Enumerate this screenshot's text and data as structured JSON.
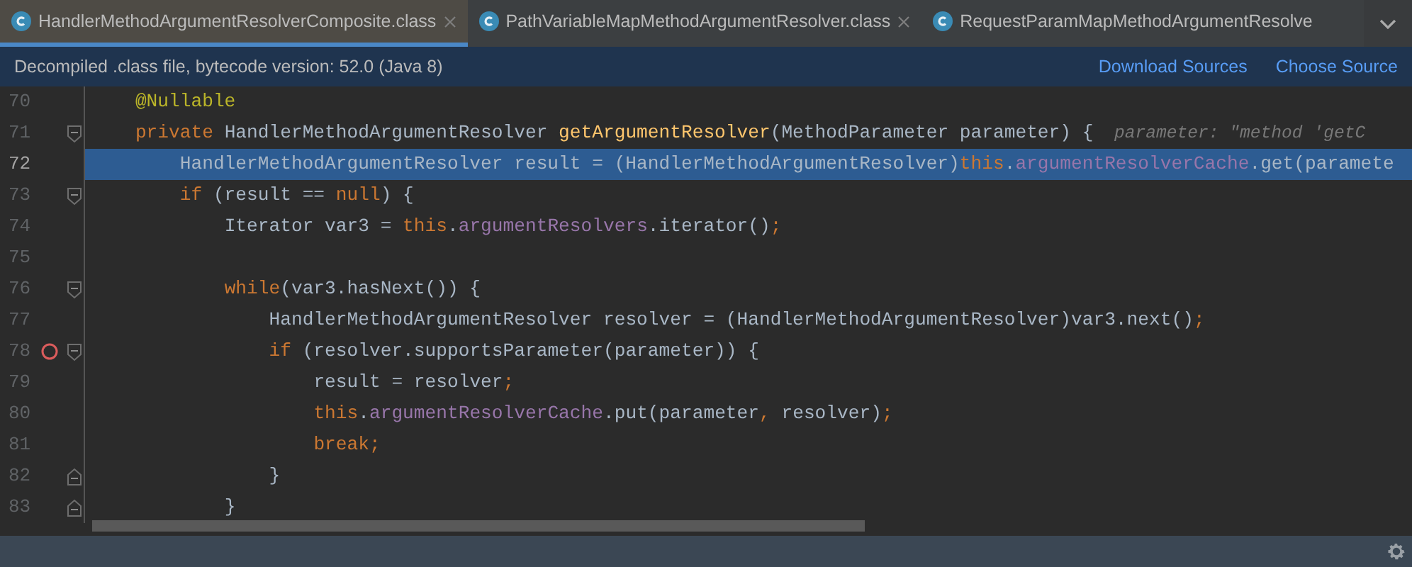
{
  "tabs": [
    {
      "label": "HandlerMethodArgumentResolverComposite.class",
      "selected": true,
      "closable": true
    },
    {
      "label": "PathVariableMapMethodArgumentResolver.class",
      "selected": false,
      "closable": true
    },
    {
      "label": "RequestParamMapMethodArgumentResolve",
      "selected": false,
      "closable": false
    }
  ],
  "notification": {
    "text": "Decompiled .class file, bytecode version: 52.0 (Java 8)",
    "links": [
      "Download Sources",
      "Choose Source"
    ]
  },
  "editor": {
    "lines": [
      {
        "number": "70",
        "selected": false,
        "breakpoint": false,
        "fold_start": false,
        "fold_end": false,
        "tokens": [
          {
            "kind": "annot",
            "t": "    @Nullable"
          }
        ]
      },
      {
        "number": "71",
        "selected": false,
        "breakpoint": false,
        "fold_start": true,
        "fold_end": false,
        "tokens": [
          {
            "kind": "kw",
            "t": "    private "
          },
          {
            "kind": "plain",
            "t": "HandlerMethodArgumentResolver "
          },
          {
            "kind": "fn",
            "t": "getArgumentResolver"
          },
          {
            "kind": "plain",
            "t": "(MethodParameter parameter) {"
          },
          {
            "kind": "hint",
            "t": "  parameter: \"method 'getC"
          }
        ]
      },
      {
        "number": "72",
        "selected": true,
        "breakpoint": false,
        "fold_start": false,
        "fold_end": false,
        "tokens": [
          {
            "kind": "plain",
            "t": "        HandlerMethodArgumentResolver result = (HandlerMethodArgumentResolver)"
          },
          {
            "kind": "kw",
            "t": "this"
          },
          {
            "kind": "plain",
            "t": "."
          },
          {
            "kind": "field",
            "t": "argumentResolverCache"
          },
          {
            "kind": "plain",
            "t": ".get(paramete"
          }
        ]
      },
      {
        "number": "73",
        "selected": false,
        "breakpoint": false,
        "fold_start": true,
        "fold_end": false,
        "tokens": [
          {
            "kind": "kw",
            "t": "        if "
          },
          {
            "kind": "plain",
            "t": "(result == "
          },
          {
            "kind": "kw",
            "t": "null"
          },
          {
            "kind": "plain",
            "t": ") {"
          }
        ]
      },
      {
        "number": "74",
        "selected": false,
        "breakpoint": false,
        "fold_start": false,
        "fold_end": false,
        "tokens": [
          {
            "kind": "plain",
            "t": "            Iterator var3 = "
          },
          {
            "kind": "kw",
            "t": "this"
          },
          {
            "kind": "plain",
            "t": "."
          },
          {
            "kind": "field",
            "t": "argumentResolvers"
          },
          {
            "kind": "plain",
            "t": ".iterator()"
          },
          {
            "kind": "kw",
            "t": ";"
          }
        ]
      },
      {
        "number": "75",
        "selected": false,
        "breakpoint": false,
        "fold_start": false,
        "fold_end": false
      },
      {
        "number": "76",
        "selected": false,
        "breakpoint": false,
        "fold_start": true,
        "fold_end": false,
        "tokens": [
          {
            "kind": "kw",
            "t": "            while"
          },
          {
            "kind": "plain",
            "t": "(var3.hasNext()) {"
          }
        ]
      },
      {
        "number": "77",
        "selected": false,
        "breakpoint": false,
        "fold_start": false,
        "fold_end": false,
        "tokens": [
          {
            "kind": "plain",
            "t": "                HandlerMethodArgumentResolver resolver = (HandlerMethodArgumentResolver)var3.next()"
          },
          {
            "kind": "kw",
            "t": ";"
          }
        ]
      },
      {
        "number": "78",
        "selected": false,
        "breakpoint": true,
        "fold_start": true,
        "fold_end": false,
        "tokens": [
          {
            "kind": "kw",
            "t": "                if "
          },
          {
            "kind": "plain",
            "t": "(resolver.supportsParameter(parameter)) {"
          }
        ]
      },
      {
        "number": "79",
        "selected": false,
        "breakpoint": false,
        "fold_start": false,
        "fold_end": false,
        "tokens": [
          {
            "kind": "plain",
            "t": "                    result = resolver"
          },
          {
            "kind": "kw",
            "t": ";"
          }
        ]
      },
      {
        "number": "80",
        "selected": false,
        "breakpoint": false,
        "fold_start": false,
        "fold_end": false,
        "tokens": [
          {
            "kind": "kw",
            "t": "                    this"
          },
          {
            "kind": "plain",
            "t": "."
          },
          {
            "kind": "field",
            "t": "argumentResolverCache"
          },
          {
            "kind": "plain",
            "t": ".put(parameter"
          },
          {
            "kind": "kw",
            "t": ", "
          },
          {
            "kind": "plain",
            "t": "resolver)"
          },
          {
            "kind": "kw",
            "t": ";"
          }
        ]
      },
      {
        "number": "81",
        "selected": false,
        "breakpoint": false,
        "fold_start": false,
        "fold_end": false,
        "tokens": [
          {
            "kind": "kw",
            "t": "                    break;"
          }
        ]
      },
      {
        "number": "82",
        "selected": false,
        "breakpoint": false,
        "fold_start": false,
        "fold_end": true,
        "tokens": [
          {
            "kind": "plain",
            "t": "                }"
          }
        ]
      },
      {
        "number": "83",
        "selected": false,
        "breakpoint": false,
        "fold_start": false,
        "fold_end": true,
        "tokens": [
          {
            "kind": "plain",
            "t": "            }"
          }
        ]
      }
    ]
  }
}
